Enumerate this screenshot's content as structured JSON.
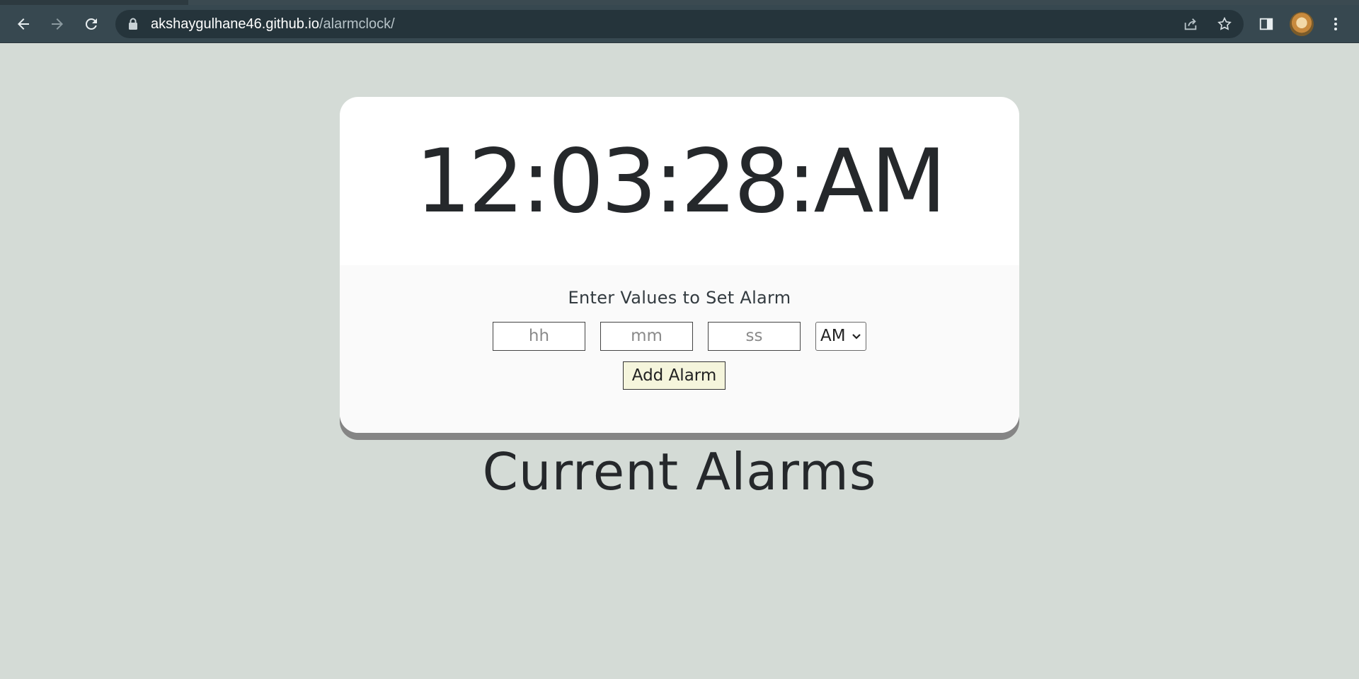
{
  "browser": {
    "url_host": "akshaygulhane46.github.io",
    "url_path": "/alarmclock/",
    "nav": {
      "back_icon": "arrow-left-icon",
      "forward_icon": "arrow-right-icon",
      "reload_icon": "reload-icon"
    },
    "colors": {
      "toolbar": "#374850",
      "omnibox": "#25343b",
      "page_bg": "#d4dbd6"
    }
  },
  "clock": {
    "time": "12:03:28:AM"
  },
  "alarm_form": {
    "title": "Enter Values to Set Alarm",
    "hours_placeholder": "hh",
    "minutes_placeholder": "mm",
    "seconds_placeholder": "ss",
    "period_selected": "AM",
    "add_button_label": "Add Alarm",
    "add_button_color": "#f5f5dc"
  },
  "alarms": {
    "heading": "Current Alarms"
  }
}
